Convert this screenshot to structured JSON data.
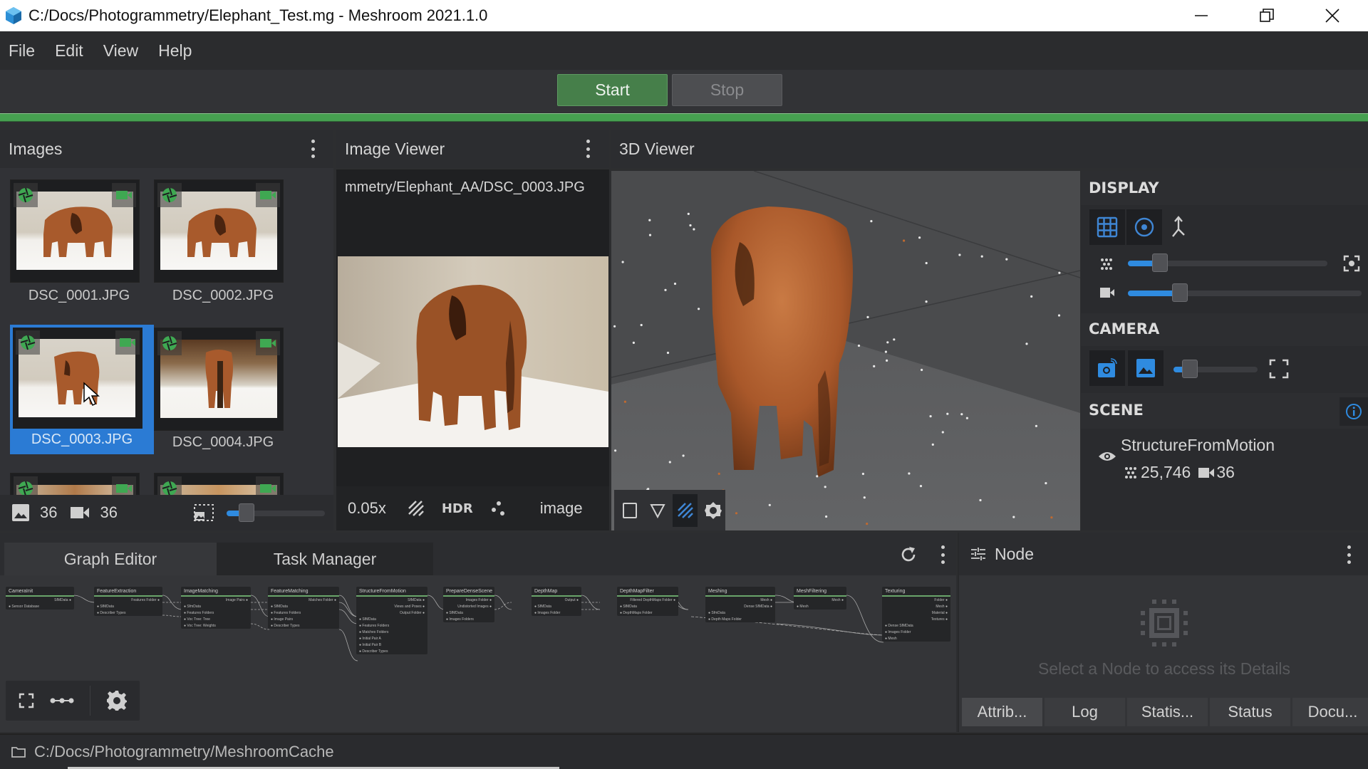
{
  "window": {
    "title": "C:/Docs/Photogrammetry/Elephant_Test.mg - Meshroom 2021.1.0",
    "controls": [
      "minimize",
      "restore",
      "close"
    ]
  },
  "menubar": {
    "items": [
      {
        "label": "File"
      },
      {
        "label": "Edit"
      },
      {
        "label": "View"
      },
      {
        "label": "Help"
      }
    ]
  },
  "toolbar": {
    "start_label": "Start",
    "stop_label": "Stop",
    "progress_percent": 100,
    "progress_color": "#46a050"
  },
  "images_panel": {
    "title": "Images",
    "thumbnails": [
      {
        "label": "DSC_0001.JPG",
        "selected": false
      },
      {
        "label": "DSC_0002.JPG",
        "selected": false
      },
      {
        "label": "DSC_0003.JPG",
        "selected": true
      },
      {
        "label": "DSC_0004.JPG",
        "selected": false
      },
      {
        "label": "",
        "selected": false
      },
      {
        "label": "",
        "selected": false
      }
    ],
    "image_count": "36",
    "camera_count": "36",
    "thumbnail_size_percent": 12
  },
  "image_viewer": {
    "title": "Image Viewer",
    "path": "mmetry/Elephant_AA/DSC_0003.JPG",
    "zoom": "0.05x",
    "hdr_label": "HDR",
    "mode_label": "image"
  },
  "viewer_3d": {
    "title": "3D Viewer",
    "tools": [
      "bounding-box",
      "frustum",
      "grid",
      "light"
    ],
    "active_tool": "grid"
  },
  "display": {
    "section_label": "DISPLAY",
    "point_size_percent": 12,
    "camera_scale_percent": 19,
    "camera_section_label": "CAMERA",
    "image_overlay_opacity_percent": 10,
    "scene_section_label": "SCENE",
    "scene_item": {
      "name": "StructureFromMotion",
      "points": "25,746",
      "cameras": "36"
    },
    "accent_color": "#2f8be0"
  },
  "bottom": {
    "tabs": [
      {
        "label": "Graph Editor",
        "active": true
      },
      {
        "label": "Task Manager",
        "active": false
      }
    ]
  },
  "graph": {
    "nodes": [
      {
        "title": "CameraInit",
        "outputs": [
          "SfMData"
        ],
        "inputs": [
          "Sensor Database"
        ]
      },
      {
        "title": "FeatureExtraction",
        "outputs": [
          "Features Folder"
        ],
        "inputs": [
          "SfMData",
          "Describer Types"
        ]
      },
      {
        "title": "ImageMatching",
        "outputs": [
          "Image Pairs"
        ],
        "inputs": [
          "SfmData",
          "Features Folders",
          "Voc Tree: Tree",
          "Voc Tree: Weights"
        ]
      },
      {
        "title": "FeatureMatching",
        "outputs": [
          "Matches Folder"
        ],
        "inputs": [
          "SfMData",
          "Features Folders",
          "Image Pairs",
          "Describer Types"
        ]
      },
      {
        "title": "StructureFromMotion",
        "outputs": [
          "SfMData",
          "Views and Poses",
          "Output Folder"
        ],
        "inputs": [
          "SfMData",
          "Features Folders",
          "Matches Folders",
          "Initial Pair A",
          "Initial Pair B",
          "Describer Types"
        ]
      },
      {
        "title": "PrepareDenseScene",
        "outputs": [
          "Images Folder",
          "Undistorted Images"
        ],
        "inputs": [
          "SfMData",
          "Images Folders"
        ]
      },
      {
        "title": "DepthMap",
        "outputs": [
          "Output"
        ],
        "inputs": [
          "SfMData",
          "Images Folder"
        ]
      },
      {
        "title": "DepthMapFilter",
        "outputs": [
          "Filtered DepthMaps Folder"
        ],
        "inputs": [
          "SfMData",
          "DepthMaps Folder"
        ]
      },
      {
        "title": "Meshing",
        "outputs": [
          "Mesh",
          "Dense SfMData"
        ],
        "inputs": [
          "SfmData",
          "Depth Maps Folder"
        ]
      },
      {
        "title": "MeshFiltering",
        "outputs": [
          "Mesh"
        ],
        "inputs": [
          "Mesh"
        ]
      },
      {
        "title": "Texturing",
        "outputs": [
          "Folder",
          "Mesh",
          "Material",
          "Textures"
        ],
        "inputs": [
          "Dense SfMData",
          "Images Folder",
          "Mesh"
        ]
      }
    ]
  },
  "node_panel": {
    "title": "Node",
    "empty_message": "Select a Node to access its Details",
    "tabs": [
      {
        "label": "Attrib...",
        "active": true
      },
      {
        "label": "Log",
        "active": false
      },
      {
        "label": "Statis...",
        "active": false
      },
      {
        "label": "Status",
        "active": false
      },
      {
        "label": "Docu...",
        "active": false
      }
    ]
  },
  "statusbar": {
    "cache_path": "C:/Docs/Photogrammetry/MeshroomCache"
  }
}
